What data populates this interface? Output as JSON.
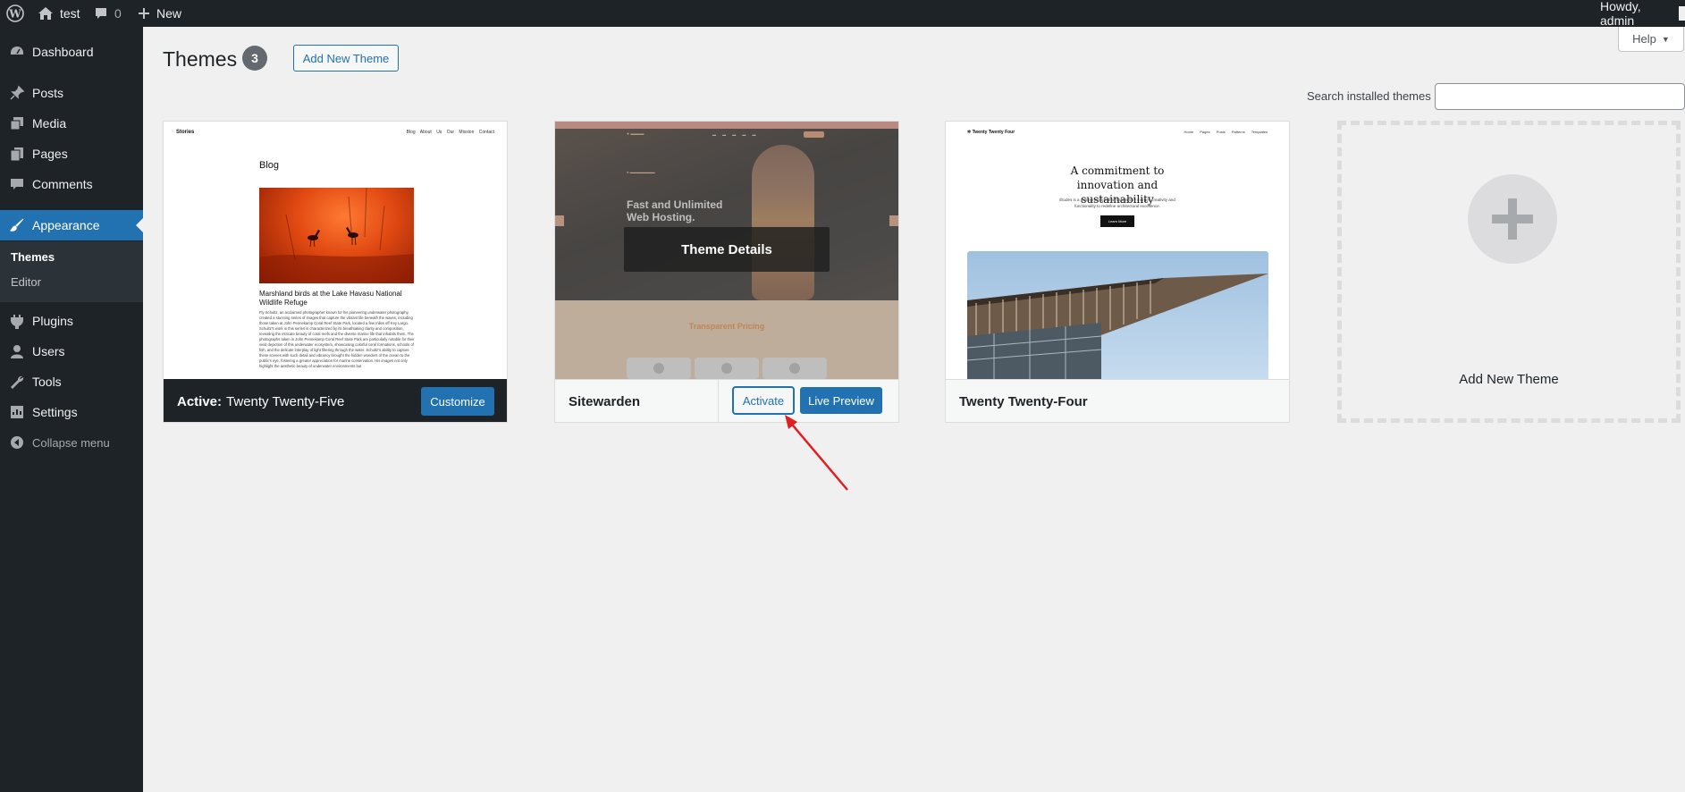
{
  "admin_bar": {
    "site_name": "test",
    "comments_count": "0",
    "new_label": "New",
    "howdy": "Howdy, admin"
  },
  "sidebar": {
    "items": [
      {
        "label": "Dashboard",
        "icon": "dashboard-icon"
      },
      {
        "label": "Posts",
        "icon": "pin-icon"
      },
      {
        "label": "Media",
        "icon": "media-icon"
      },
      {
        "label": "Pages",
        "icon": "pages-icon"
      },
      {
        "label": "Comments",
        "icon": "comment-icon"
      },
      {
        "label": "Appearance",
        "icon": "brush-icon"
      },
      {
        "label": "Plugins",
        "icon": "plugin-icon"
      },
      {
        "label": "Users",
        "icon": "user-icon"
      },
      {
        "label": "Tools",
        "icon": "wrench-icon"
      },
      {
        "label": "Settings",
        "icon": "settings-icon"
      }
    ],
    "submenu": [
      "Themes",
      "Editor"
    ],
    "collapse_label": "Collapse menu"
  },
  "header": {
    "title": "Themes",
    "count": "3",
    "add_new_label": "Add New Theme",
    "help_label": "Help",
    "search_label": "Search installed themes",
    "search_value": ""
  },
  "themes": [
    {
      "active_prefix": "Active:",
      "name": "Twenty Twenty-Five",
      "button": "Customize",
      "preview": {
        "brand": "Stories",
        "nav": "Blog About Us Our Mission Contact",
        "heading": "Blog",
        "caption": "Marshland birds at the Lake Havasu National Wildlife Refuge",
        "body": "Fly Schultz, an acclaimed photographer known for his pioneering underwater photography, created a stunning series of images that capture the vibrant life beneath the waves, including those taken at John Pennekamp Coral Reef State Park, located a few miles off Key Largo. Schultz's work in this series is characterized by its breathtaking clarity and composition, revealing the intricate beauty of coral reefs and the diverse marine life that inhabits them. The photographs taken in John Pennekamp Coral Reef State Park are particularly notable for their vivid depiction of this underwater ecosystem, showcasing colorful coral formations, schools of fish, and the delicate interplay of light filtering through the water. Schultz's ability to capture these scenes with such detail and vibrancy brought the hidden wonders of the ocean to the public's eye, fostering a greater appreciation for marine conservation. His images not only highlight the aesthetic beauty of underwater environments but"
      }
    },
    {
      "name": "Sitewarden",
      "details_label": "Theme Details",
      "activate_label": "Activate",
      "preview_label": "Live Preview",
      "preview": {
        "hero_title": "Fast and Unlimited Web Hosting.",
        "pricing_title": "Transparent Pricing"
      }
    },
    {
      "name": "Twenty Twenty-Four",
      "preview": {
        "brand": "Twenty Twenty Four",
        "nav": "Home Pages Posts Patterns Templates",
        "heading": "A commitment to innovation and sustainability",
        "body": "Études is a pioneering firm that seamlessly merges creativity and functionality to redefine architectural excellence.",
        "button": "Learn More"
      }
    }
  ],
  "add_new_tile": {
    "label": "Add New Theme"
  },
  "annotation": {
    "color": "#e02020"
  }
}
